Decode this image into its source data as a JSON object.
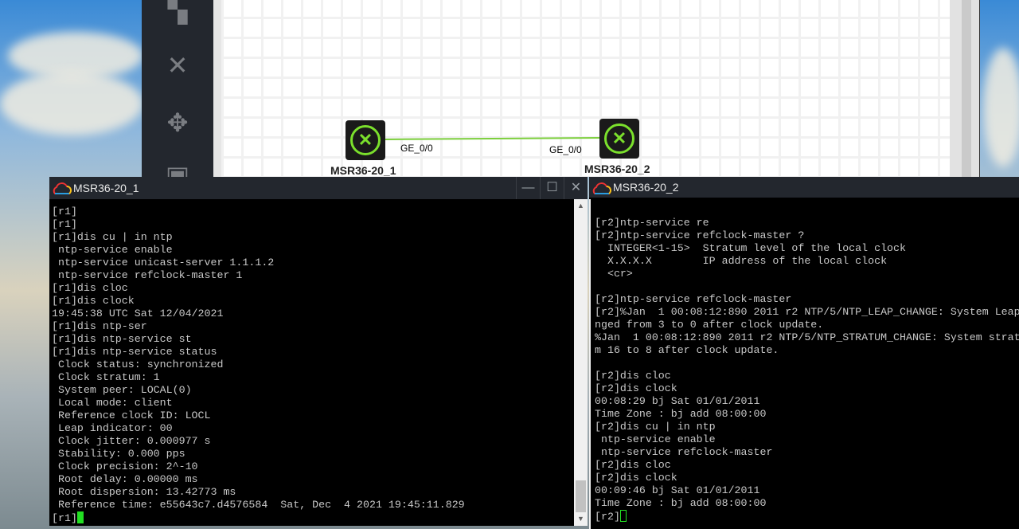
{
  "colors": {
    "accent_green": "#7be02c",
    "terminal_bg": "#000000",
    "titlebar_bg": "#23272e",
    "cursor": "#22e022"
  },
  "topology": {
    "nodes": [
      {
        "label": "MSR36-20_1",
        "port": "GE_0/0"
      },
      {
        "label": "MSR36-20_2",
        "port": "GE_0/0"
      }
    ],
    "sidebar_icons": [
      "switch-icon",
      "router-icon",
      "move-icon",
      "firewall-icon"
    ]
  },
  "terminal1": {
    "title": "MSR36-20_1",
    "minimize": "—",
    "maximize": "☐",
    "close": "✕",
    "lines": [
      "[r1]",
      "[r1]",
      "[r1]dis cu | in ntp",
      " ntp-service enable",
      " ntp-service unicast-server 1.1.1.2",
      " ntp-service refclock-master 1",
      "[r1]dis cloc",
      "[r1]dis clock",
      "19:45:38 UTC Sat 12/04/2021",
      "[r1]dis ntp-ser",
      "[r1]dis ntp-service st",
      "[r1]dis ntp-service status",
      " Clock status: synchronized",
      " Clock stratum: 1",
      " System peer: LOCAL(0)",
      " Local mode: client",
      " Reference clock ID: LOCL",
      " Leap indicator: 00",
      " Clock jitter: 0.000977 s",
      " Stability: 0.000 pps",
      " Clock precision: 2^-10",
      " Root delay: 0.00000 ms",
      " Root dispersion: 13.42773 ms",
      " Reference time: e55643c7.d4576584  Sat, Dec  4 2021 19:45:11.829"
    ],
    "prompt": "[r1]"
  },
  "terminal2": {
    "title": "MSR36-20_2",
    "lines": [
      "",
      "[r2]ntp-service re",
      "[r2]ntp-service refclock-master ?",
      "  INTEGER<1-15>  Stratum level of the local clock",
      "  X.X.X.X        IP address of the local clock",
      "  <cr>",
      "",
      "[r2]ntp-service refclock-master",
      "[r2]%Jan  1 00:08:12:890 2011 r2 NTP/5/NTP_LEAP_CHANGE: System Leap",
      "nged from 3 to 0 after clock update.",
      "%Jan  1 00:08:12:890 2011 r2 NTP/5/NTP_STRATUM_CHANGE: System strat",
      "m 16 to 8 after clock update.",
      "",
      "[r2]dis cloc",
      "[r2]dis clock",
      "00:08:29 bj Sat 01/01/2011",
      "Time Zone : bj add 08:00:00",
      "[r2]dis cu | in ntp",
      " ntp-service enable",
      " ntp-service refclock-master",
      "[r2]dis cloc",
      "[r2]dis clock",
      "00:09:46 bj Sat 01/01/2011",
      "Time Zone : bj add 08:00:00"
    ],
    "prompt": "[r2]"
  }
}
